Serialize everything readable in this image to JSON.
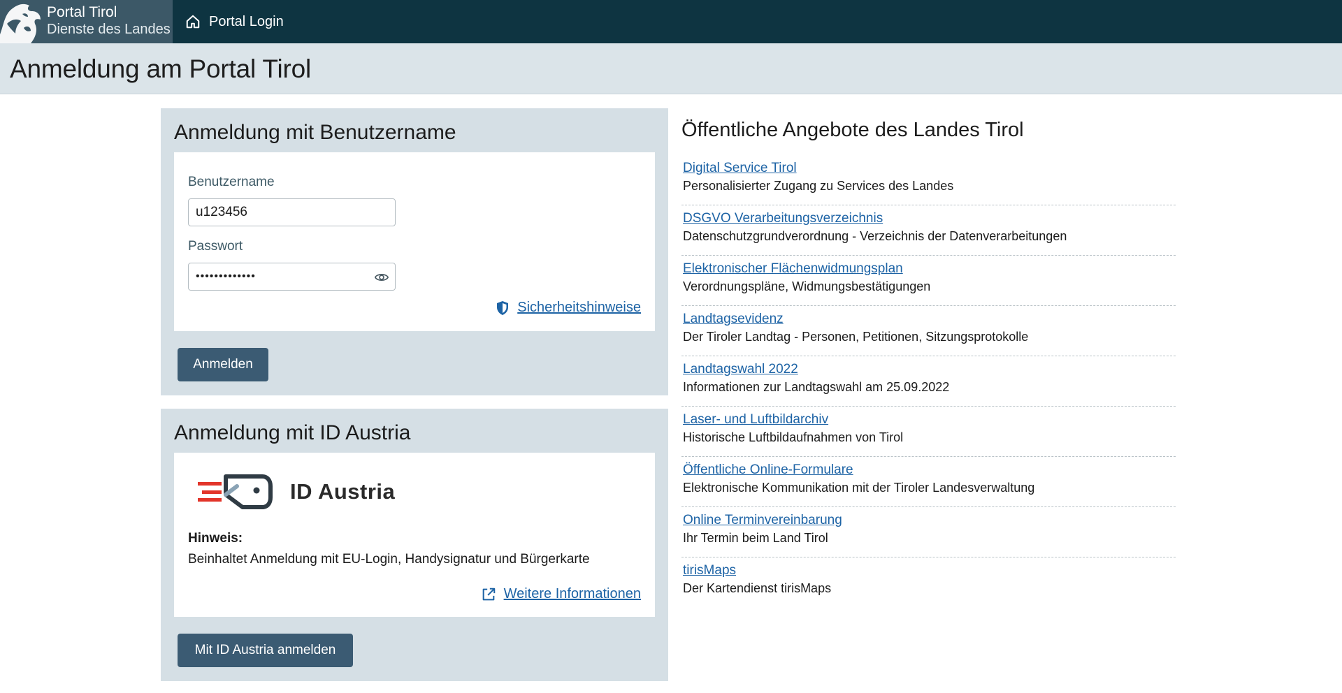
{
  "header": {
    "brand_title": "Portal Tirol",
    "brand_subtitle": "Dienste des Landes",
    "nav_login": "Portal Login",
    "colors": {
      "bar": "#0e3441",
      "brand_bg": "#3c5867"
    }
  },
  "page_title": "Anmeldung am Portal Tirol",
  "login_username": {
    "heading": "Anmeldung mit Benutzername",
    "username_label": "Benutzername",
    "username_value": "u123456",
    "password_label": "Passwort",
    "password_value": "•••••••••••••",
    "security_link": "Sicherheitshinweise",
    "submit_label": "Anmelden"
  },
  "login_id_austria": {
    "heading": "Anmeldung mit ID Austria",
    "logo_text": "ID Austria",
    "note_title": "Hinweis:",
    "note_text": "Beinhaltet Anmeldung mit EU-Login, Handysignatur und Bürgerkarte",
    "more_link": "Weitere Informationen",
    "submit_label": "Mit ID Austria anmelden"
  },
  "offers": {
    "heading": "Öffentliche Angebote des Landes Tirol",
    "items": [
      {
        "title": "Digital Service Tirol",
        "desc": "Personalisierter Zugang zu Services des Landes"
      },
      {
        "title": "DSGVO Verarbeitungsverzeichnis",
        "desc": "Datenschutzgrundverordnung - Verzeichnis der Datenverarbeitungen"
      },
      {
        "title": "Elektronischer Flächenwidmungsplan",
        "desc": "Verordnungspläne, Widmungsbestätigungen"
      },
      {
        "title": "Landtagsevidenz",
        "desc": "Der Tiroler Landtag - Personen, Petitionen, Sitzungsprotokolle"
      },
      {
        "title": "Landtagswahl 2022",
        "desc": "Informationen zur Landtagswahl am 25.09.2022"
      },
      {
        "title": "Laser- und Luftbildarchiv",
        "desc": "Historische Luftbildaufnahmen von Tirol"
      },
      {
        "title": "Öffentliche Online-Formulare",
        "desc": "Elektronische Kommunikation mit der Tiroler Landesverwaltung"
      },
      {
        "title": "Online Terminvereinbarung",
        "desc": "Ihr Termin beim Land Tirol"
      },
      {
        "title": "tirisMaps",
        "desc": "Der Kartendienst tirisMaps"
      }
    ]
  },
  "icons": [
    "tirol-eagle-logo-icon",
    "home-icon",
    "eye-icon",
    "shield-icon",
    "id-austria-key-icon",
    "external-link-icon"
  ]
}
